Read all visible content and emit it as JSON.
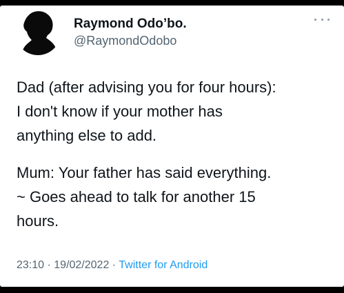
{
  "tweet": {
    "author_name": "Raymond Odo’bo.",
    "author_handle": "@RaymondOdobo",
    "more_icon": "more-horizontal-icon",
    "paragraphs": [
      {
        "lines": [
          "Dad (after advising you for four hours):",
          "I don't know if your mother has",
          "anything else to add."
        ]
      },
      {
        "lines": [
          "Mum: Your father has said everything.",
          "~ Goes ahead to talk for another 15",
          "hours."
        ]
      }
    ],
    "time": "23:10",
    "separator": " · ",
    "date": "19/02/2022",
    "source": "Twitter for Android"
  },
  "colors": {
    "text": "#0f1419",
    "secondary": "#536471",
    "link": "#1d9bf0",
    "frame": "#000000"
  }
}
